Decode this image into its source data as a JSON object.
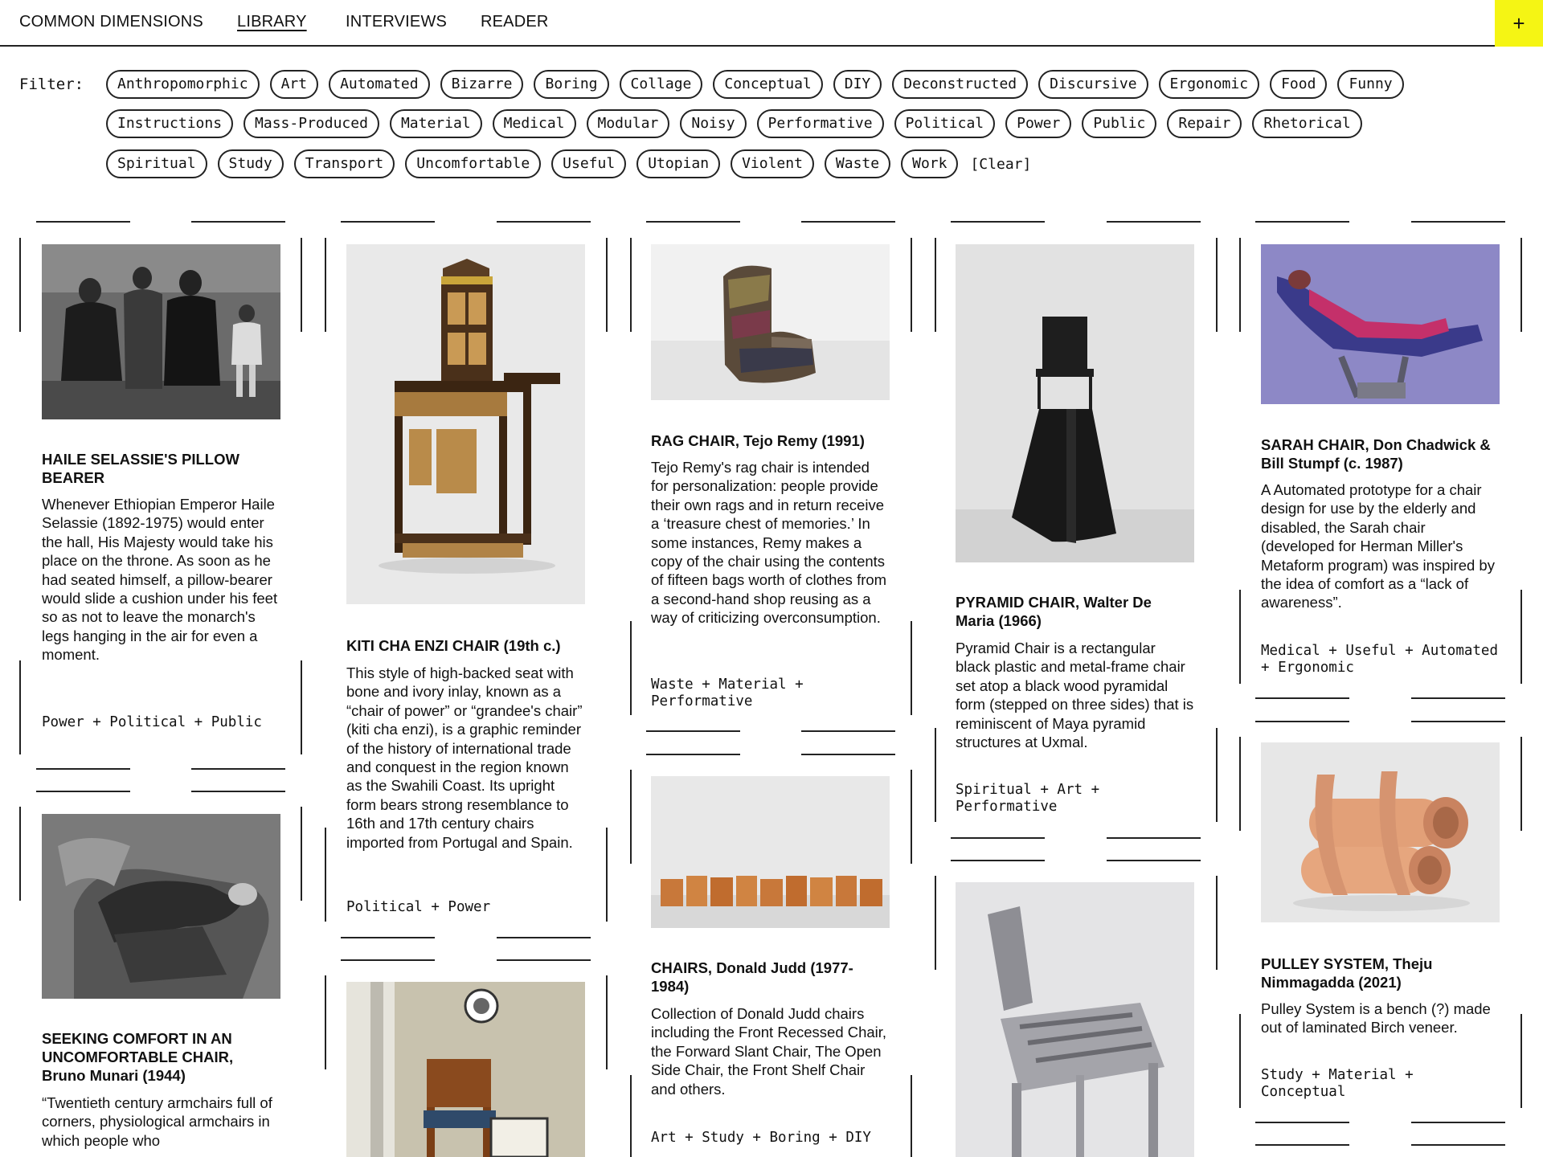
{
  "nav": {
    "items": [
      "COMMON DIMENSIONS",
      "LIBRARY",
      "INTERVIEWS",
      "READER"
    ],
    "add_label": "+"
  },
  "filter": {
    "label": "Filter:",
    "tags": [
      "Anthropomorphic",
      "Art",
      "Automated",
      "Bizarre",
      "Boring",
      "Collage",
      "Conceptual",
      "DIY",
      "Deconstructed",
      "Discursive",
      "Ergonomic",
      "Food",
      "Funny",
      "Instructions",
      "Mass-Produced",
      "Material",
      "Medical",
      "Modular",
      "Noisy",
      "Performative",
      "Political",
      "Power",
      "Public",
      "Repair",
      "Rhetorical",
      "Spiritual",
      "Study",
      "Transport",
      "Uncomfortable",
      "Useful",
      "Utopian",
      "Violent",
      "Waste",
      "Work"
    ],
    "clear_label": "[Clear]"
  },
  "cards": {
    "haile": {
      "title": "HAILE SELASSIE'S PILLOW BEARER",
      "description": "Whenever Ethiopian Emperor Haile Selassie (1892-1975) would enter the hall, His Majesty would take his place on the throne. As soon as he had seated himself, a pillow-bearer would slide a cushion under his feet so as not to leave the monarch's legs hanging in the air for even a moment.",
      "tags": "Power + Political + Public"
    },
    "munari": {
      "title": "SEEKING COMFORT IN AN UNCOMFORTABLE CHAIR, Bruno Munari (1944)",
      "description": "“Twentieth century armchairs full of corners, physiological armchairs in which people who"
    },
    "kiti": {
      "title": "KITI CHA ENZI CHAIR (19th c.)",
      "description": "This style of high-backed seat with bone and ivory inlay, known as a “chair of power” or “grandee's chair” (kiti cha enzi), is a graphic reminder of the history of international trade and conquest in the region known as the Swahili Coast. Its upright form bears strong resemblance to 16th and 17th century chairs imported from Portugal and Spain.",
      "tags": "Political + Power"
    },
    "rag": {
      "title": "RAG CHAIR, Tejo Remy (1991)",
      "description": "Tejo Remy's rag chair is intended for personalization: people provide their own rags and in return receive a ‘treasure chest of memories.’ In some instances, Remy makes a copy of the chair using the contents of fifteen bags worth of clothes from a second-hand shop reusing as a way of criticizing overconsumption.",
      "tags": "Waste + Material + Performative"
    },
    "judd": {
      "title": "CHAIRS, Donald Judd (1977-1984)",
      "description": "Collection of Donald Judd chairs including the Front Recessed Chair, the Forward Slant Chair, The Open Side Chair, the Front Shelf Chair and others.",
      "tags": "Art + Study + Boring + DIY"
    },
    "pyramid": {
      "title": "PYRAMID CHAIR, Walter De Maria (1966)",
      "description": "Pyramid Chair is a rectangular black plastic and metal-frame chair set atop a black wood pyramidal form (stepped on three sides) that is reminiscent of Maya pyramid structures at Uxmal.",
      "tags": "Spiritual + Art + Performative"
    },
    "sarah": {
      "title": "SARAH CHAIR, Don Chadwick & Bill Stumpf (c. 1987)",
      "description": "A Automated prototype for a chair design for use by the elderly and disabled, the Sarah chair (developed for Herman Miller's Metaform program) was inspired by the idea of comfort as a “lack of awareness”.",
      "tags": "Medical + Useful + Automated + Ergonomic"
    },
    "pulley": {
      "title": "PULLEY SYSTEM, Theju Nimmagadda (2021)",
      "description": "Pulley System is a bench (?) made out of laminated Birch veneer.",
      "tags": "Study + Material + Conceptual"
    }
  }
}
